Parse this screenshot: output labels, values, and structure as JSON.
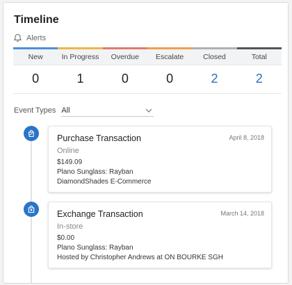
{
  "header": {
    "title": "Timeline",
    "alerts_label": "Alerts"
  },
  "stats": [
    {
      "label": "New",
      "value": "0",
      "color": "#4a90d9",
      "link": false
    },
    {
      "label": "In Progress",
      "value": "1",
      "color": "#e8b84a",
      "link": false
    },
    {
      "label": "Overdue",
      "value": "0",
      "color": "#e07a6f",
      "link": false
    },
    {
      "label": "Escalate",
      "value": "0",
      "color": "#eda04b",
      "link": false
    },
    {
      "label": "Closed",
      "value": "2",
      "color": "#b0b0b0",
      "link": true
    },
    {
      "label": "Total",
      "value": "2",
      "color": "#555555",
      "link": true
    }
  ],
  "filter": {
    "label": "Event Types",
    "value": "All"
  },
  "events": [
    {
      "title": "Purchase Transaction",
      "date": "April 8, 2018",
      "channel": "Online",
      "lines": [
        "$149.09",
        "Plano Sunglass: Rayban",
        "DiamondShades E-Commerce"
      ],
      "icon": "shopping-bag-icon"
    },
    {
      "title": "Exchange Transaction",
      "date": "March 14, 2018",
      "channel": "In-store",
      "lines": [
        "$0.00",
        "Plano Sunglass: Rayban",
        "Hosted by Christopher Andrews at ON BOURKE SGH"
      ],
      "icon": "store-bag-icon"
    }
  ],
  "accent_color": "#2b74c9"
}
